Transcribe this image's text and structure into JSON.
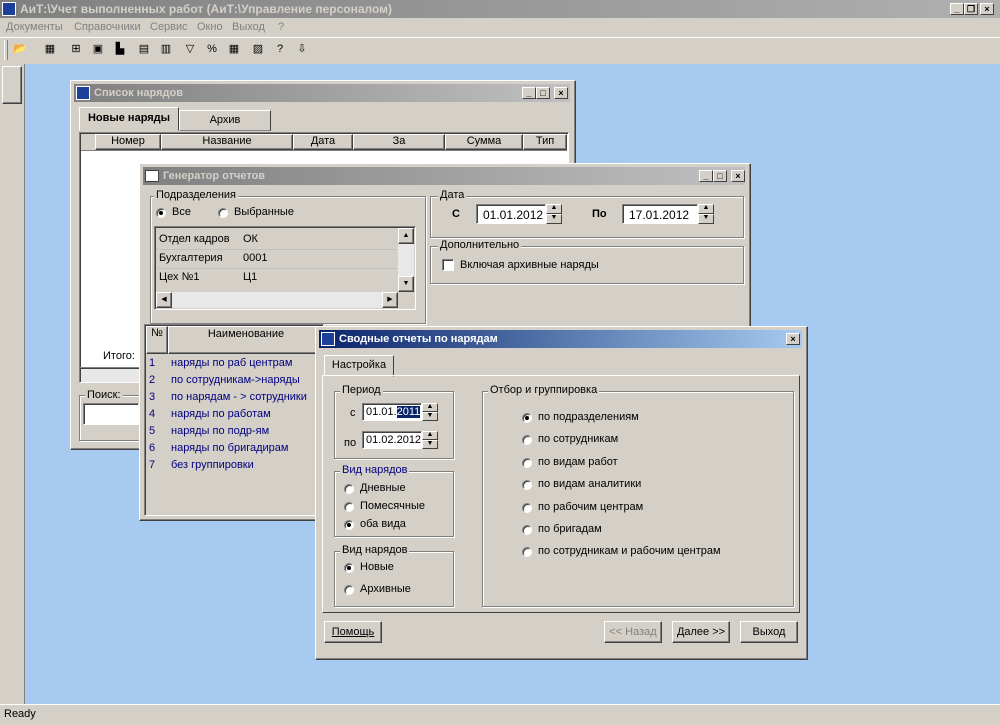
{
  "app": {
    "title": "АиТ:\\Учет выполненных работ  (АиТ:\\Управление персоналом)",
    "menu": [
      "Документы",
      "Справочники",
      "Сервис",
      "Окно",
      "Выход",
      "?"
    ],
    "status": "Ready",
    "workspace_color": "#a6caf0"
  },
  "toolbar": {
    "icons": [
      "open-folder-icon",
      "calendar-icon",
      "network-icon",
      "card-icon",
      "building-icon",
      "table-icon",
      "report-icon",
      "filter-icon",
      "percent-icon",
      "calculator-icon",
      "grid-icon",
      "help-icon",
      "exit-icon"
    ]
  },
  "orders_list": {
    "title": "Список нарядов",
    "tabs": [
      "Новые наряды",
      "Архив"
    ],
    "columns": [
      "Номер",
      "Название",
      "Дата",
      "За",
      "Сумма",
      "Тип"
    ],
    "total_label": "Итого: !",
    "search_label": "Поиск:"
  },
  "report_gen": {
    "title": "Генератор отчетов",
    "divisions_label": "Подразделения",
    "radio_all": "Все",
    "radio_selected": "Выбранные",
    "divisions": [
      {
        "name": "Отдел кадров",
        "code": "ОК"
      },
      {
        "name": "Бухгалтерия",
        "code": "0001"
      },
      {
        "name": "Цех №1",
        "code": "Ц1"
      }
    ],
    "date_label": "Дата",
    "from_label": "С",
    "from_value": "01.01.2012",
    "to_label": "По",
    "to_value": "17.01.2012",
    "extra_label": "Дополнительно",
    "include_archive": "Включая архивные наряды",
    "reports_cols": [
      "№",
      "Наименование"
    ],
    "reports": [
      {
        "n": "1",
        "name": "наряды по раб центрам"
      },
      {
        "n": "2",
        "name": "по сотрудникам->наряды"
      },
      {
        "n": "3",
        "name": "по нарядам - > сотрудники"
      },
      {
        "n": "4",
        "name": "наряды по работам"
      },
      {
        "n": "5",
        "name": "наряды по подр-ям"
      },
      {
        "n": "6",
        "name": "наряды по бригадирам"
      },
      {
        "n": "7",
        "name": "без группировки"
      }
    ]
  },
  "summary": {
    "title": "Сводные отчеты по нарядам",
    "tab": "Настройка",
    "period_label": "Период",
    "from_label": "с",
    "from_value_prefix": "01.01.",
    "from_value_selected": "2011",
    "to_label": "по",
    "to_value": "01.02.2012",
    "order_type_label": "Вид нарядов",
    "order_types": [
      "Дневные",
      "Помесячные",
      "оба вида"
    ],
    "order_kind_label": "Вид нарядов",
    "order_kinds": [
      "Новые",
      "Архивные"
    ],
    "grouping_label": "Отбор и группировка",
    "grouping": [
      "по подразделениям",
      "по сотрудникам",
      "по видам работ",
      "по видам аналитики",
      "по рабочим центрам",
      "по бригадам",
      "по сотрудникам и рабочим центрам"
    ],
    "btn_help": "Помощь",
    "btn_back": "<< Назад",
    "btn_next": "Далее >>",
    "btn_exit": "Выход"
  }
}
